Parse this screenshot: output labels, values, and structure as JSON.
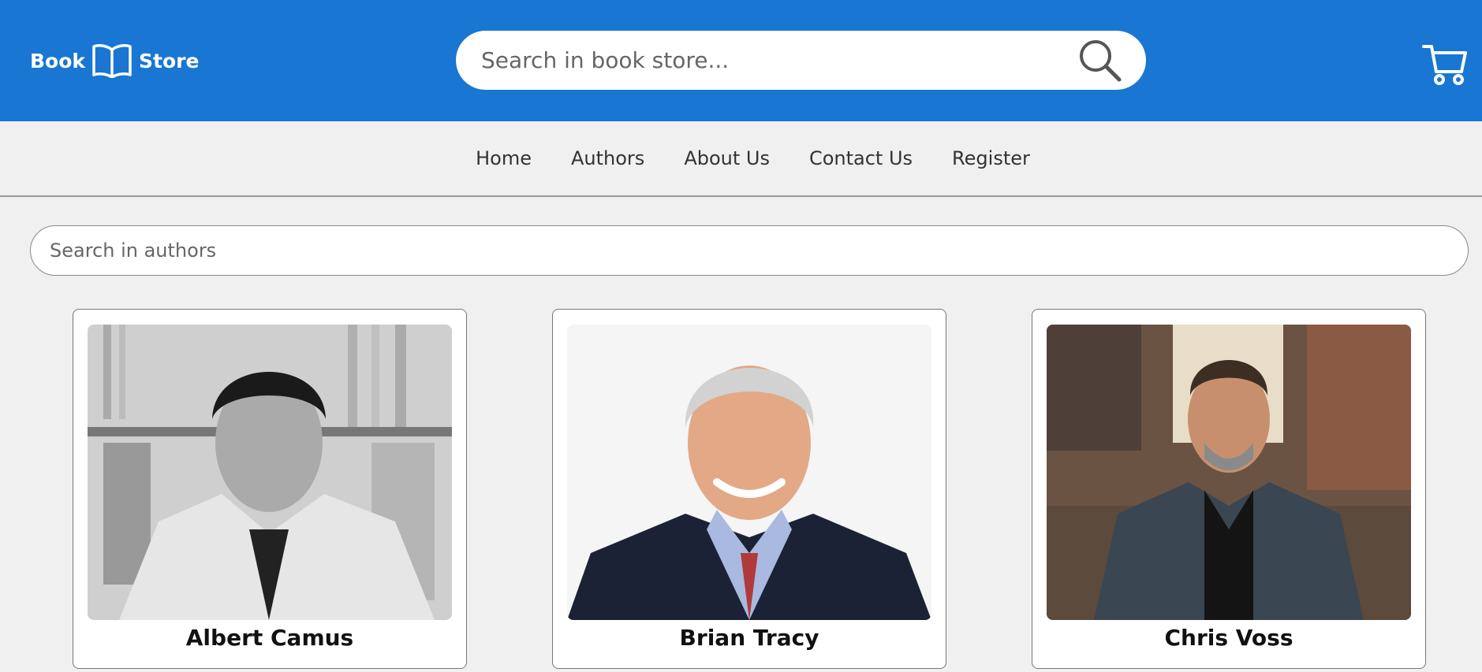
{
  "header": {
    "logo_left": "Book",
    "logo_right": "Store",
    "search_placeholder": "Search in book store..."
  },
  "nav": {
    "items": [
      "Home",
      "Authors",
      "About Us",
      "Contact Us",
      "Register"
    ]
  },
  "authors_search": {
    "placeholder": "Search in authors"
  },
  "authors": [
    {
      "name": "Albert Camus"
    },
    {
      "name": "Brian Tracy"
    },
    {
      "name": "Chris Voss"
    }
  ],
  "colors": {
    "brand": "#1976d2",
    "background": "#f0f0f0"
  }
}
